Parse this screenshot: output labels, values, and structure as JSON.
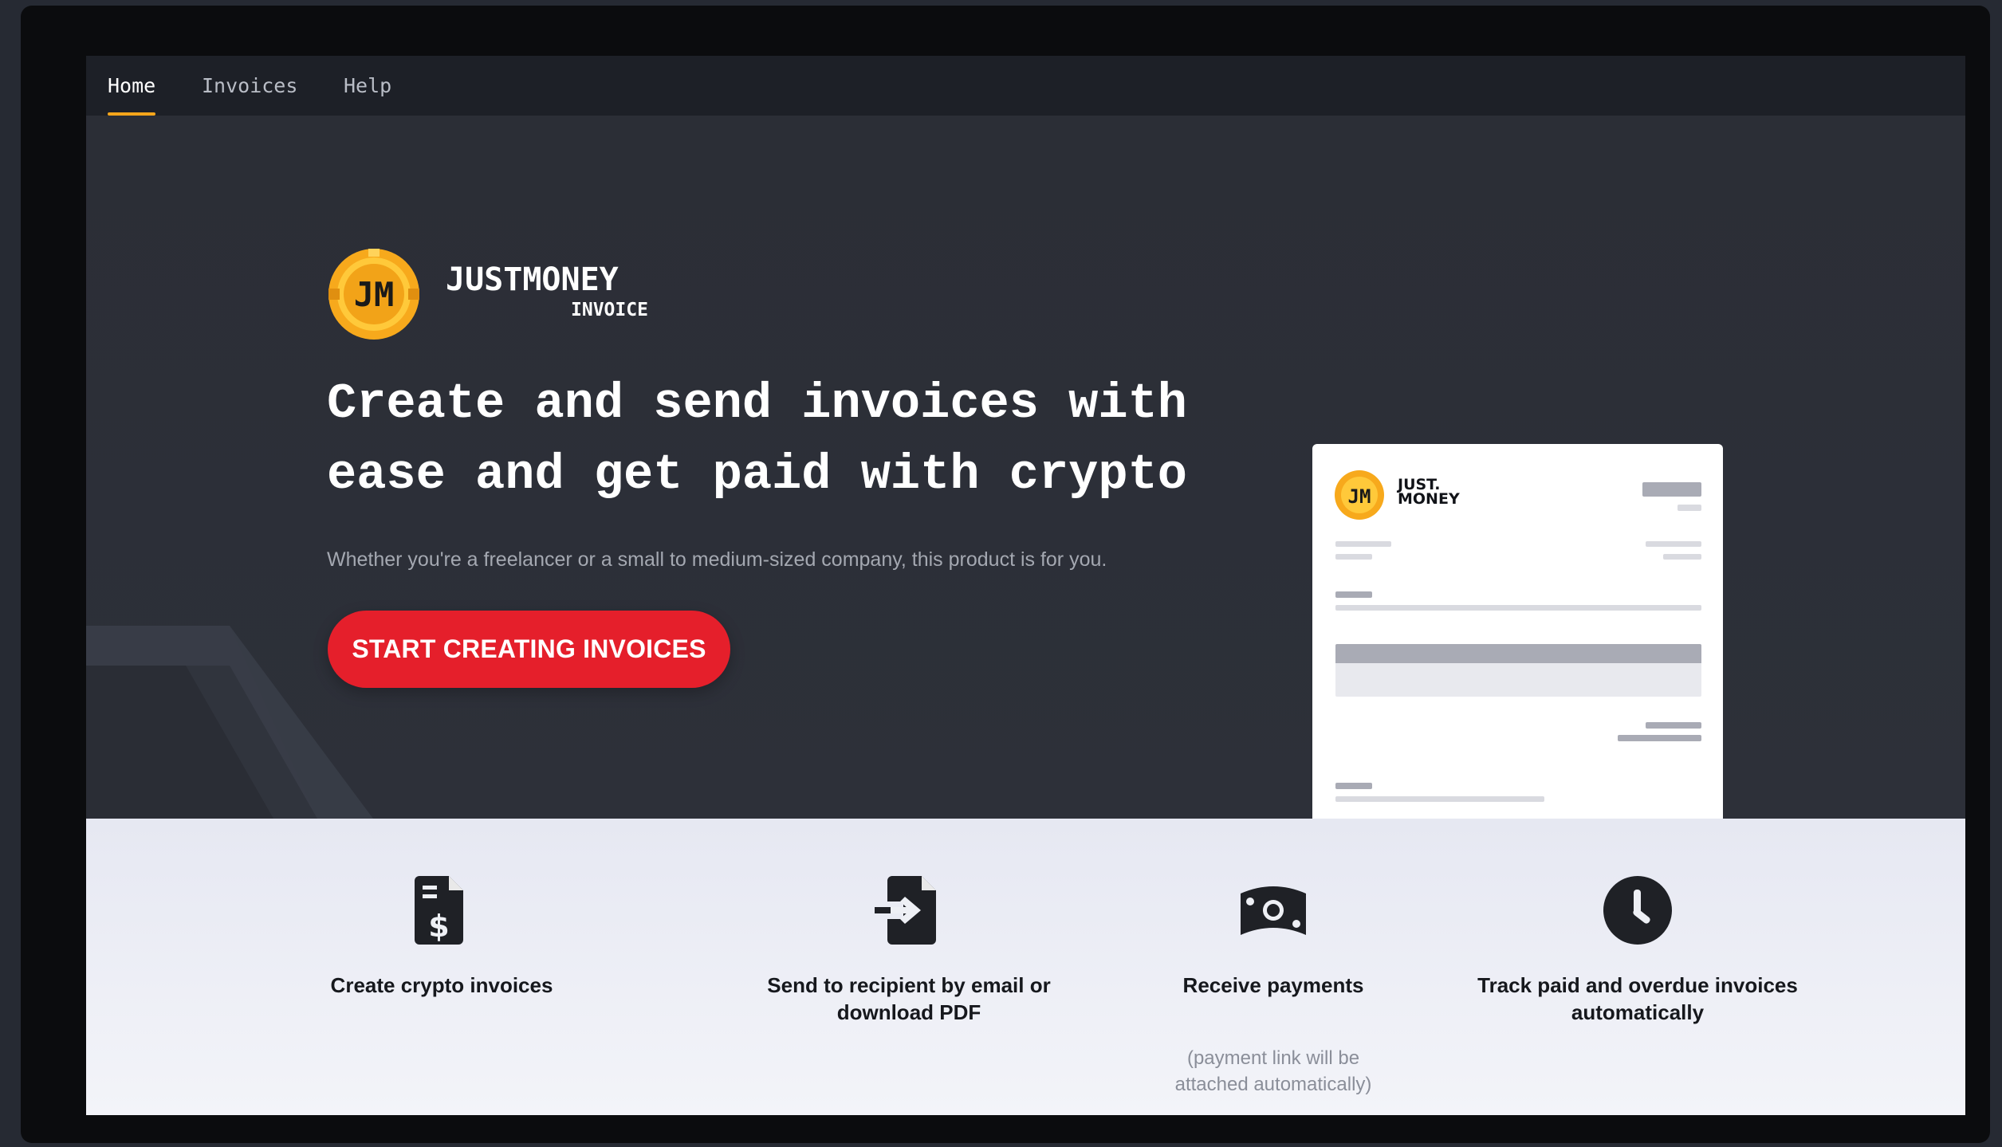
{
  "nav": {
    "items": [
      {
        "label": "Home",
        "active": true
      },
      {
        "label": "Invoices",
        "active": false
      },
      {
        "label": "Help",
        "active": false
      }
    ]
  },
  "brand": {
    "name": "JUSTMONEY",
    "product": "INVOICE",
    "coin_initials": "JM"
  },
  "hero": {
    "headline_line1": "Create and send invoices with",
    "headline_line2": "ease and get paid with crypto",
    "subtitle": "Whether you're a freelancer or a small to medium-sized company, this product is for you.",
    "cta_label": "START CREATING INVOICES"
  },
  "preview": {
    "brand_line1": "JUST.",
    "brand_line2": "MONEY"
  },
  "features": [
    {
      "title": "Create crypto invoices",
      "note": "",
      "icon": "invoice-dollar-icon"
    },
    {
      "title": "Send to recipient by email or download PDF",
      "note": "",
      "icon": "file-send-icon"
    },
    {
      "title": "Receive payments",
      "note": "(payment link will be attached automatically)",
      "icon": "money-bill-icon"
    },
    {
      "title": "Track paid and overdue invoices automatically",
      "note": "",
      "icon": "clock-icon"
    }
  ],
  "colors": {
    "accent": "#f5a51b",
    "cta": "#e51f2b",
    "hero_bg": "#2c2f37",
    "nav_bg": "#1d2027",
    "features_bg": "#eceef5"
  }
}
